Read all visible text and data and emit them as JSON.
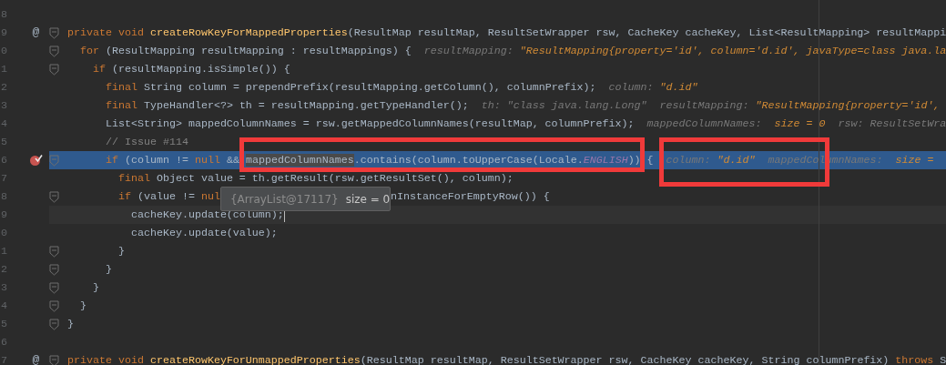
{
  "editor": {
    "lines": [
      {
        "no": "8",
        "breakpoint": false,
        "fold": false,
        "highlighted": false,
        "caret": false
      },
      {
        "no": "9",
        "gutter_mark": "@",
        "breakpoint": false,
        "fold": true,
        "highlighted": false,
        "caret": false,
        "code": [
          {
            "kind": "kw",
            "text": "private void "
          },
          {
            "kind": "decl",
            "text": "createRowKeyForMappedProperties"
          },
          {
            "kind": "plain",
            "text": "(ResultMap resultMap, ResultSetWrapper rsw, CacheKey cacheKey, List<ResultMapping> resultMappi"
          }
        ]
      },
      {
        "no": "0",
        "breakpoint": false,
        "fold": true,
        "highlighted": false,
        "caret": false,
        "code": [
          {
            "kind": "kw",
            "text": "  for "
          },
          {
            "kind": "plain",
            "text": "(ResultMapping resultMapping : resultMappings) {"
          }
        ],
        "hints": [
          [
            {
              "kind": "hint",
              "text": "resultMapping: "
            },
            {
              "kind": "hintval",
              "text": "\"ResultMapping{property='id', column='d.id', javaType=class java.la"
            }
          ]
        ]
      },
      {
        "no": "1",
        "breakpoint": false,
        "fold": true,
        "highlighted": false,
        "caret": false,
        "code": [
          {
            "kind": "kw",
            "text": "    if "
          },
          {
            "kind": "plain",
            "text": "(resultMapping.isSimple()) {"
          }
        ]
      },
      {
        "no": "2",
        "breakpoint": false,
        "fold": false,
        "highlighted": false,
        "caret": false,
        "code": [
          {
            "kind": "kw",
            "text": "      final "
          },
          {
            "kind": "plain",
            "text": "String column = prependPrefix(resultMapping.getColumn(), columnPrefix);"
          }
        ],
        "hints": [
          [
            {
              "kind": "hint",
              "text": "column: "
            },
            {
              "kind": "hintval",
              "text": "\"d.id\""
            }
          ]
        ]
      },
      {
        "no": "3",
        "breakpoint": false,
        "fold": false,
        "highlighted": false,
        "caret": false,
        "code": [
          {
            "kind": "kw",
            "text": "      final "
          },
          {
            "kind": "plain",
            "text": "TypeHandler<?> th = resultMapping.getTypeHandler();"
          }
        ],
        "hints": [
          [
            {
              "kind": "hint",
              "text": "th: \"class java.lang.Long\""
            }
          ],
          [
            {
              "kind": "hint",
              "text": "resultMapping: "
            },
            {
              "kind": "hintval",
              "text": "\"ResultMapping{property='id',"
            }
          ]
        ]
      },
      {
        "no": "4",
        "breakpoint": false,
        "fold": false,
        "highlighted": false,
        "caret": false,
        "code": [
          {
            "kind": "plain",
            "text": "      List<String> mappedColumnNames = rsw.getMappedColumnNames(resultMap, columnPrefix);"
          }
        ],
        "hints": [
          [
            {
              "kind": "hint",
              "text": "mappedColumnNames:  "
            },
            {
              "kind": "hintval",
              "text": "size = 0"
            }
          ],
          [
            {
              "kind": "hint",
              "text": "rsw: ResultSetWra"
            }
          ]
        ]
      },
      {
        "no": "5",
        "breakpoint": false,
        "fold": false,
        "highlighted": false,
        "caret": false,
        "code": [
          {
            "kind": "comment",
            "text": "      // Issue #114"
          }
        ]
      },
      {
        "no": "6",
        "breakpoint": true,
        "fold": true,
        "highlighted": true,
        "caret": false,
        "code": [
          {
            "kind": "kw",
            "text": "      if "
          },
          {
            "kind": "plain",
            "text": "(column != "
          },
          {
            "kind": "kw",
            "text": "null "
          },
          {
            "kind": "plain",
            "text": "&& "
          },
          {
            "kind": "sel",
            "text": "mappedColumnNames"
          },
          {
            "kind": "plain",
            "text": ".contains(column.toUpperCase(Locale."
          },
          {
            "kind": "const",
            "text": "ENGLISH"
          },
          {
            "kind": "plain",
            "text": ")) {"
          }
        ],
        "hints": [
          [
            {
              "kind": "hint",
              "text": "column: "
            },
            {
              "kind": "hintval",
              "text": "\"d.id\""
            }
          ],
          [
            {
              "kind": "hint",
              "text": "mappedColumnNames:  "
            },
            {
              "kind": "hintval",
              "text": "size ="
            }
          ]
        ]
      },
      {
        "no": "7",
        "breakpoint": false,
        "fold": false,
        "highlighted": false,
        "caret": false,
        "code": [
          {
            "kind": "kw",
            "text": "        final "
          },
          {
            "kind": "plain",
            "text": "Object value = th.getResult(rsw.getResultSet(), column);"
          }
        ]
      },
      {
        "no": "8",
        "breakpoint": false,
        "fold": true,
        "highlighted": false,
        "caret": false,
        "code": [
          {
            "kind": "kw",
            "text": "        if "
          },
          {
            "kind": "plain",
            "text": "(value != "
          },
          {
            "kind": "kw",
            "text": "nul"
          }
        ],
        "tooltip": {
          "object": "{ArrayList@17117}",
          "value": "size = 0"
        },
        "code_after": [
          {
            "kind": "plain",
            "text": "nInstanceForEmptyRow()) {"
          }
        ]
      },
      {
        "no": "9",
        "breakpoint": false,
        "fold": false,
        "highlighted": false,
        "caret": true,
        "code": [
          {
            "kind": "plain",
            "text": "          cacheKey.update(column);"
          }
        ]
      },
      {
        "no": "0",
        "breakpoint": false,
        "fold": false,
        "highlighted": false,
        "caret": false,
        "code": [
          {
            "kind": "plain",
            "text": "          cacheKey.update(value);"
          }
        ]
      },
      {
        "no": "1",
        "breakpoint": false,
        "fold": true,
        "highlighted": false,
        "caret": false,
        "code": [
          {
            "kind": "plain",
            "text": "        }"
          }
        ]
      },
      {
        "no": "2",
        "breakpoint": false,
        "fold": true,
        "highlighted": false,
        "caret": false,
        "code": [
          {
            "kind": "plain",
            "text": "      }"
          }
        ]
      },
      {
        "no": "3",
        "breakpoint": false,
        "fold": true,
        "highlighted": false,
        "caret": false,
        "code": [
          {
            "kind": "plain",
            "text": "    }"
          }
        ]
      },
      {
        "no": "4",
        "breakpoint": false,
        "fold": true,
        "highlighted": false,
        "caret": false,
        "code": [
          {
            "kind": "plain",
            "text": "  }"
          }
        ]
      },
      {
        "no": "5",
        "breakpoint": false,
        "fold": true,
        "highlighted": false,
        "caret": false,
        "code": [
          {
            "kind": "plain",
            "text": "}"
          }
        ]
      },
      {
        "no": "6",
        "breakpoint": false,
        "fold": false,
        "highlighted": false,
        "caret": false
      },
      {
        "no": "7",
        "gutter_mark": "@",
        "breakpoint": false,
        "fold": true,
        "highlighted": false,
        "caret": false,
        "code": [
          {
            "kind": "kw",
            "text": "private void "
          },
          {
            "kind": "decl",
            "text": "createRowKeyForUnmappedProperties"
          },
          {
            "kind": "plain",
            "text": "(ResultMap resultMap, ResultSetWrapper rsw, CacheKey cacheKey, String columnPrefix) "
          },
          {
            "kind": "kw",
            "text": "throws "
          },
          {
            "kind": "plain",
            "text": "S"
          }
        ]
      }
    ]
  },
  "annotation_boxes": [
    {
      "kind": "frame"
    },
    {
      "kind": "frame"
    }
  ]
}
